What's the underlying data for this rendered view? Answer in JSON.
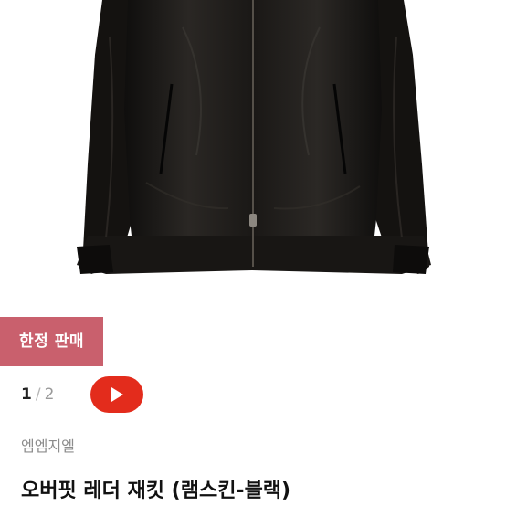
{
  "product": {
    "badge": "한정 판매",
    "pager": {
      "current": "1",
      "separator": "/",
      "total": "2"
    },
    "brand": "엠엠지엘",
    "title": "오버핏 레더 재킷 (램스킨-블랙)"
  },
  "colors": {
    "badge_background": "#c9606d",
    "play_button": "#e32c1c",
    "jacket": "#1a1816"
  },
  "icons": {
    "play": "play-icon"
  }
}
